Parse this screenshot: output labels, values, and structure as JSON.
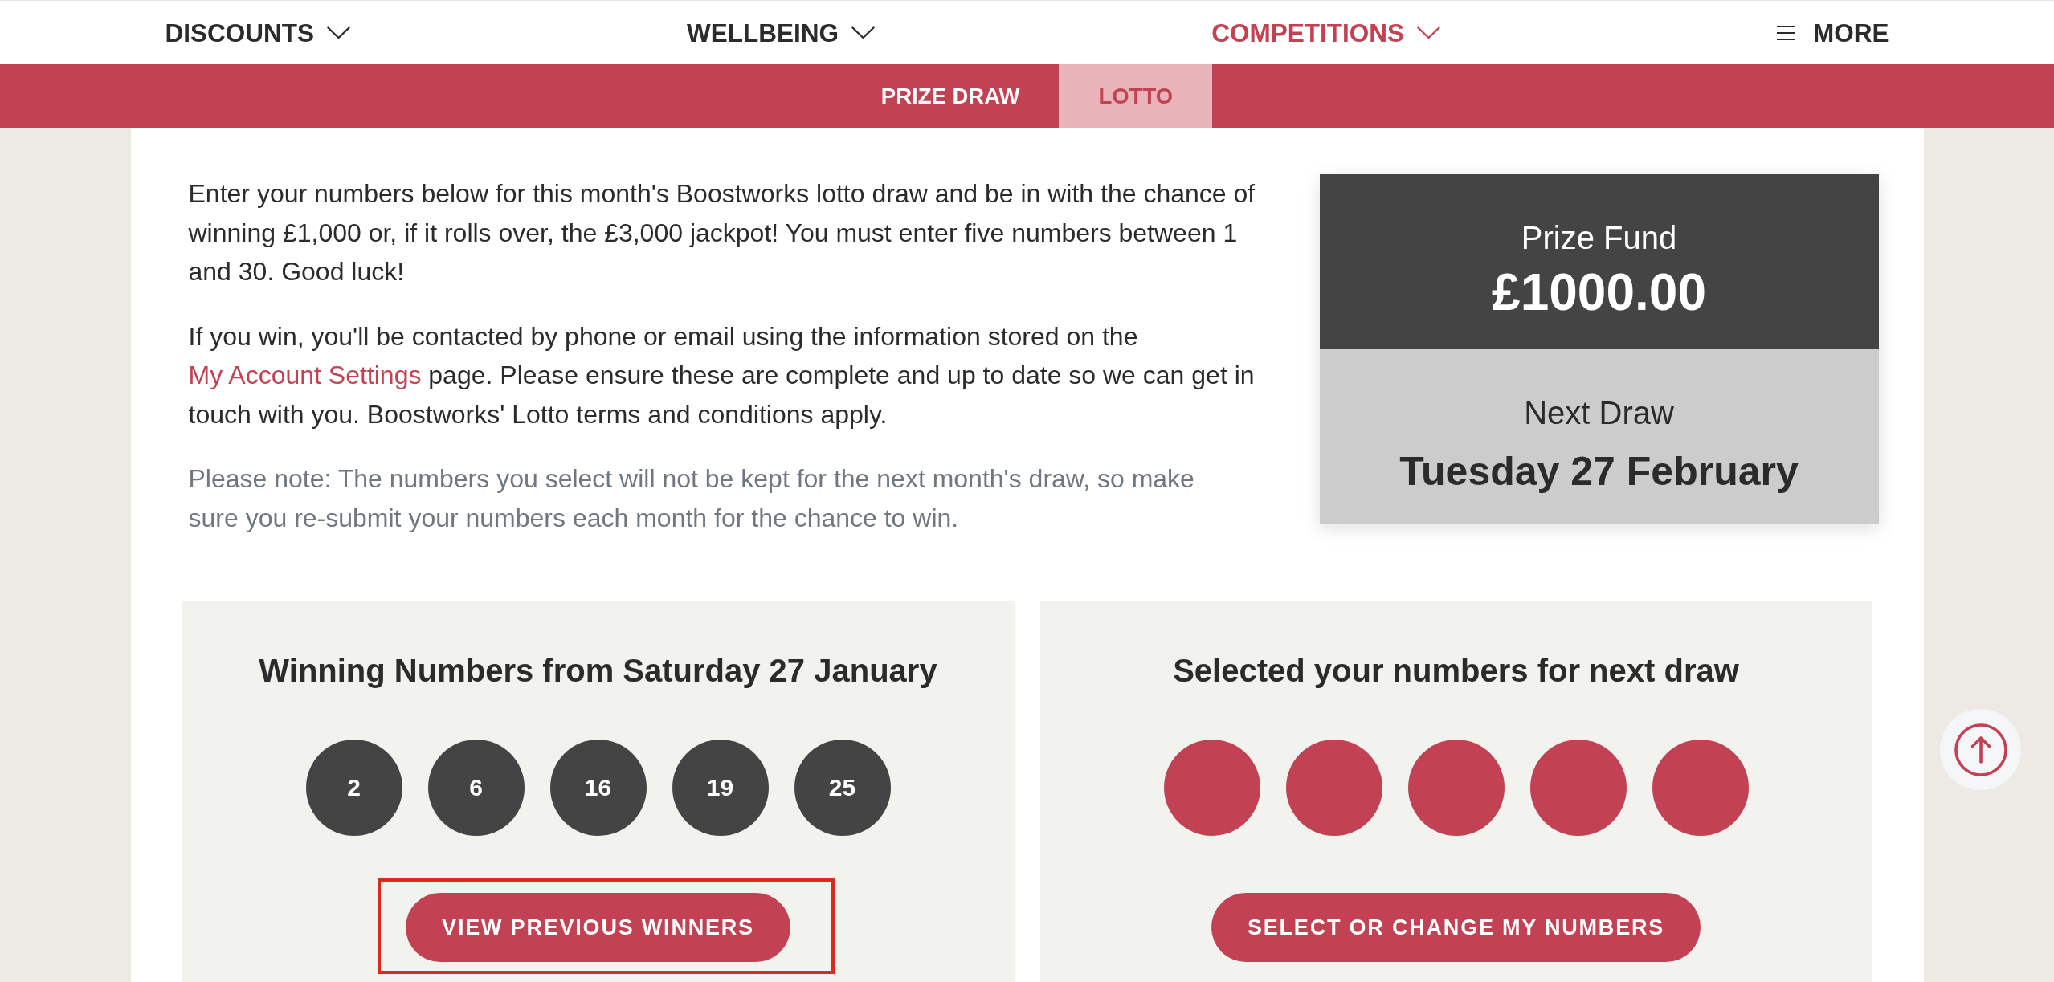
{
  "nav": {
    "items": [
      {
        "label": "DISCOUNTS",
        "kind": "dropdown",
        "selected": false
      },
      {
        "label": "WELLBEING",
        "kind": "dropdown",
        "selected": false
      },
      {
        "label": "COMPETITIONS",
        "kind": "dropdown",
        "selected": true
      },
      {
        "label": "MORE",
        "kind": "menu",
        "selected": false
      }
    ]
  },
  "subnav": {
    "tabs": [
      {
        "label": "PRIZE DRAW",
        "selected": false
      },
      {
        "label": "LOTTO",
        "selected": true
      }
    ]
  },
  "intro": {
    "paragraphs": [
      {
        "kind": "body",
        "parts": [
          {
            "kind": "text",
            "text": "Enter your numbers below for this month's Boostworks lotto draw and be in with the chance of winning £1,000 or, if it rolls over, the £3,000 jackpot! You must enter five numbers between 1 and 30. Good luck!"
          }
        ]
      },
      {
        "kind": "body",
        "parts": [
          {
            "kind": "text",
            "text": "If you win, you'll be contacted by phone or email using the information stored on the "
          },
          {
            "kind": "link",
            "text": "My Account Settings"
          },
          {
            "kind": "text",
            "text": " page. Please ensure these are complete and up to date so we can get in touch with you. Boostworks' Lotto terms and conditions apply."
          }
        ]
      },
      {
        "kind": "note",
        "parts": [
          {
            "kind": "text",
            "text": "Please note: The numbers you select will not be kept for the next month's draw, so make sure you re-submit your numbers each month for the chance to win."
          }
        ]
      }
    ]
  },
  "prize": {
    "fund": {
      "label": "Prize Fund",
      "amount": "£1000.00"
    },
    "next_draw": {
      "label": "Next Draw",
      "date": "Tuesday 27 February"
    }
  },
  "panels": [
    {
      "title": "Winning Numbers from Saturday 27 January",
      "balls": [
        {
          "kind": "drawn",
          "number": "2"
        },
        {
          "kind": "drawn",
          "number": "6"
        },
        {
          "kind": "drawn",
          "number": "16"
        },
        {
          "kind": "drawn",
          "number": "19"
        },
        {
          "kind": "drawn",
          "number": "25"
        }
      ],
      "button": {
        "label": "VIEW PREVIOUS WINNERS",
        "highlighted": true
      }
    },
    {
      "title": "Selected your numbers for next draw",
      "balls": [
        {
          "kind": "empty"
        },
        {
          "kind": "empty"
        },
        {
          "kind": "empty"
        },
        {
          "kind": "empty"
        },
        {
          "kind": "empty"
        }
      ],
      "button": {
        "label": "SELECT OR CHANGE MY NUMBERS",
        "highlighted": false
      }
    }
  ]
}
